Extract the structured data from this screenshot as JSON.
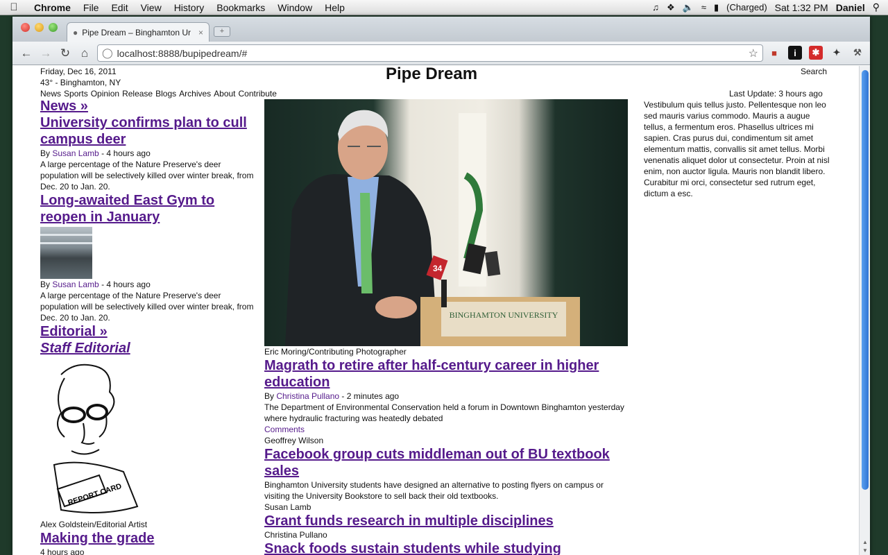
{
  "menubar": {
    "app": "Chrome",
    "items": [
      "File",
      "Edit",
      "View",
      "History",
      "Bookmarks",
      "Window",
      "Help"
    ],
    "battery": "(Charged)",
    "clock": "Sat 1:32 PM",
    "user": "Daniel"
  },
  "tab": {
    "title": "Pipe Dream – Binghamton Ur",
    "close": "×"
  },
  "omnibox": {
    "url": "localhost:8888/bupipedream/#"
  },
  "page": {
    "date": "Friday, Dec 16, 2011",
    "weather": "43° - Binghamton, NY",
    "masthead": "Pipe Dream",
    "search": "Search",
    "last_update": "Last Update: 3 hours ago",
    "nav": [
      "News",
      "Sports",
      "Opinion",
      "Release",
      "Blogs",
      "Archives",
      "About",
      "Contribute"
    ],
    "left": {
      "news_head": "News »",
      "story1": {
        "headline": "University confirms plan to cull campus deer",
        "by": "By ",
        "author": "Susan Lamb",
        "time": " - 4 hours ago",
        "summary": "A large percentage of the Nature Preserve's deer population will be selectively killed over winter break, from Dec. 20 to Jan. 20."
      },
      "story2": {
        "headline": "Long-awaited East Gym to reopen in January",
        "by": "By ",
        "author": "Susan Lamb",
        "time": " - 4 hours ago",
        "summary": "A large percentage of the Nature Preserve's deer population will be selectively killed over winter break, from Dec. 20 to Jan. 20."
      },
      "editorial_head": "Editorial »",
      "staff_editorial": "Staff Editorial",
      "cartoon_caption": "Alex Goldstein/Editorial Artist",
      "cartoon_text": "REPORT CARD",
      "story3": {
        "headline": "Making the grade",
        "time": "4 hours ago"
      }
    },
    "middle": {
      "photo_caption": "Eric Moring/Contributing Photographer",
      "podium_text": "BINGHAMTON UNIVERSITY",
      "mic_label": "34",
      "lead": {
        "headline": "Magrath to retire after half-century career in higher education",
        "by": "By ",
        "author": "Christina Pullano",
        "time": " - 2 minutes ago",
        "summary": "The Department of Environmental Conservation held a forum in Downtown Binghamton yesterday where hydraulic fracturing was heatedly debated",
        "comments": "Comments",
        "next_author": "Geoffrey Wilson"
      },
      "story2": {
        "headline": "Facebook group cuts middleman out of BU textbook sales",
        "summary": "Binghamton University students have designed an alternative to posting flyers on campus or visiting the University Bookstore to sell back their old textbooks.",
        "author": "Susan Lamb"
      },
      "story3": {
        "headline": "Grant funds research in multiple disciplines",
        "author": "Christina Pullano"
      },
      "story4": {
        "headline": "Snack foods sustain students while studying"
      }
    },
    "right": {
      "blurb": "Vestibulum quis tellus justo. Pellentesque non leo sed mauris varius commodo. Mauris a augue tellus, a fermentum eros. Phasellus ultrices mi sapien. Cras purus dui, condimentum sit amet elementum mattis, convallis sit amet tellus. Morbi venenatis aliquet dolor ut consectetur. Proin at nisl enim, non auctor ligula. Mauris non blandit libero. Curabitur mi orci, consectetur sed rutrum eget, dictum a esc."
    }
  }
}
